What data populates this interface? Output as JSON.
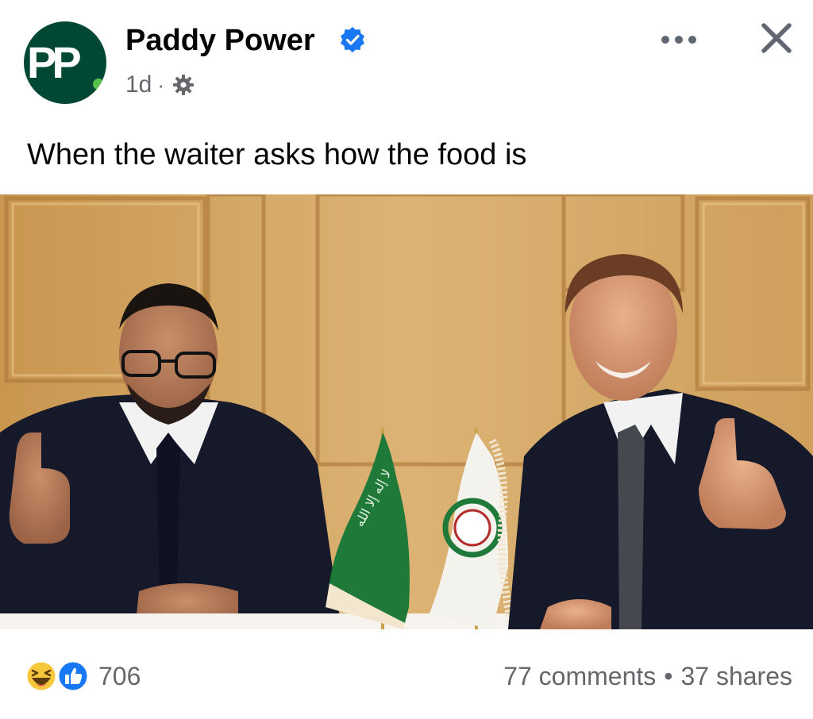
{
  "post": {
    "page_name": "Paddy Power",
    "avatar_text": "PP",
    "timestamp": "1d",
    "meta_separator": "·",
    "caption": "When the waiter asks how the food is",
    "privacy_icon": "settings-gear-icon",
    "verified_icon": "verified-badge-icon"
  },
  "actions": {
    "more_icon": "more-options-icon",
    "close_icon": "close-icon"
  },
  "photo": {
    "flag_left_script": "لا إله إلا الله"
  },
  "footer": {
    "reaction_icons": [
      "haha-reaction-icon",
      "like-reaction-icon"
    ],
    "reaction_count": "706",
    "comments": "77 comments",
    "separator": "•",
    "shares": "37 shares"
  },
  "colors": {
    "brand_green": "#004833",
    "accent_green": "#58c34a",
    "verified_blue": "#1877f2",
    "secondary_text": "#65676b"
  }
}
